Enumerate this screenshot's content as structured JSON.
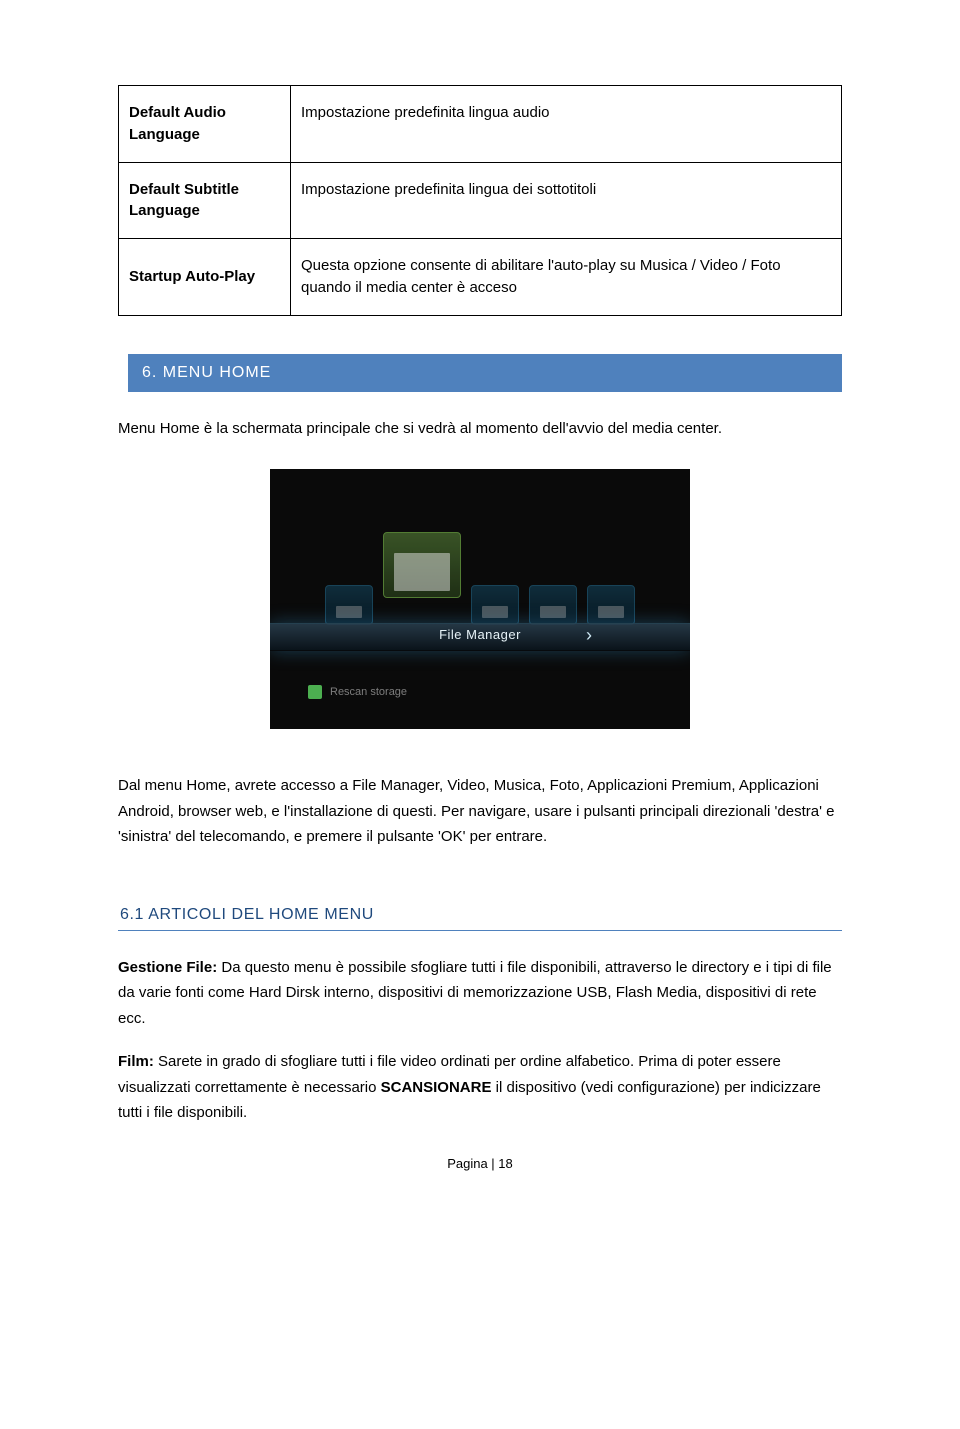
{
  "settings_table": {
    "rows": [
      {
        "label": "Default Audio Language",
        "desc": "Impostazione predefinita lingua audio"
      },
      {
        "label": "Default Subtitle Language",
        "desc": "Impostazione predefinita lingua dei sottotitoli"
      },
      {
        "label": "Startup Auto-Play",
        "desc": "Questa opzione consente di abilitare l'auto-play su Musica / Video / Foto quando il media center è acceso"
      }
    ]
  },
  "section6": {
    "heading": "6. MENU HOME",
    "intro": "Menu Home è la schermata principale che si vedrà al momento dell'avvio del media center.",
    "screenshot": {
      "selected_label": "File Manager",
      "rescan_label": "Rescan storage"
    },
    "paragraph": "Dal menu Home, avrete accesso a File Manager, Video, Musica, Foto, Applicazioni Premium, Applicazioni Android, browser web, e l'installazione di questi. Per navigare, usare i pulsanti principali direzionali 'destra' e 'sinistra' del telecomando, e premere il pulsante 'OK' per entrare."
  },
  "section6_1": {
    "heading": "6.1 ARTICOLI DEL HOME MENU",
    "para1_bold": "Gestione File:",
    "para1_rest": " Da questo menu è possibile sfogliare tutti i file disponibili, attraverso le directory e i tipi di file da varie fonti come Hard Dirsk interno, dispositivi di memorizzazione USB, Flash Media, dispositivi di rete ecc.",
    "para2_bold": "Film:",
    "para2_rest_a": " Sarete in grado di sfogliare tutti i file video ordinati per ordine alfabetico. Prima di poter essere visualizzati correttamente è necessario ",
    "para2_strong": "SCANSIONARE",
    "para2_rest_b": " il dispositivo (vedi configurazione) per indicizzare tutti i file disponibili."
  },
  "footer": "Pagina | 18"
}
